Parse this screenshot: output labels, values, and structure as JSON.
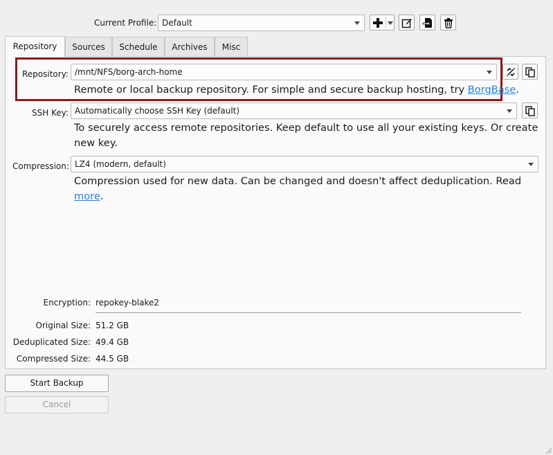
{
  "profile": {
    "label": "Current Profile:",
    "value": "Default"
  },
  "toolbar_icons": [
    "add-icon",
    "dropdown-icon",
    "edit-icon",
    "export-icon",
    "trash-icon"
  ],
  "tabs": [
    {
      "label": "Repository",
      "active": true
    },
    {
      "label": "Sources"
    },
    {
      "label": "Schedule"
    },
    {
      "label": "Archives"
    },
    {
      "label": "Misc"
    }
  ],
  "repository": {
    "label": "Repository:",
    "value": "/mnt/NFS/borg-arch-home",
    "help_text": "Remote or local backup repository. For simple and secure backup hosting, try ",
    "help_link": "BorgBase",
    "help_end": "."
  },
  "ssh": {
    "label": "SSH Key:",
    "value": "Automatically choose SSH Key (default)",
    "help_line1": "To securely access remote repositories. Keep default to use all your existing keys. Or create",
    "help_line2": "new key."
  },
  "compression": {
    "label": "Compression:",
    "value": "LZ4 (modern, default)",
    "help_text": "Compression used for new data. Can be changed and doesn't affect deduplication. Read ",
    "help_link": "more",
    "help_end": "."
  },
  "info": {
    "encryption_label": "Encryption:",
    "encryption_value": "repokey-blake2",
    "original_label": "Original Size:",
    "original_value": "51.2 GB",
    "dedup_label": "Deduplicated Size:",
    "dedup_value": "49.4 GB",
    "compressed_label": "Compressed Size:",
    "compressed_value": "44.5 GB"
  },
  "buttons": {
    "start": "Start Backup",
    "cancel": "Cancel"
  },
  "colors": {
    "highlight": "#8b1a1a",
    "link": "#2a82da"
  }
}
